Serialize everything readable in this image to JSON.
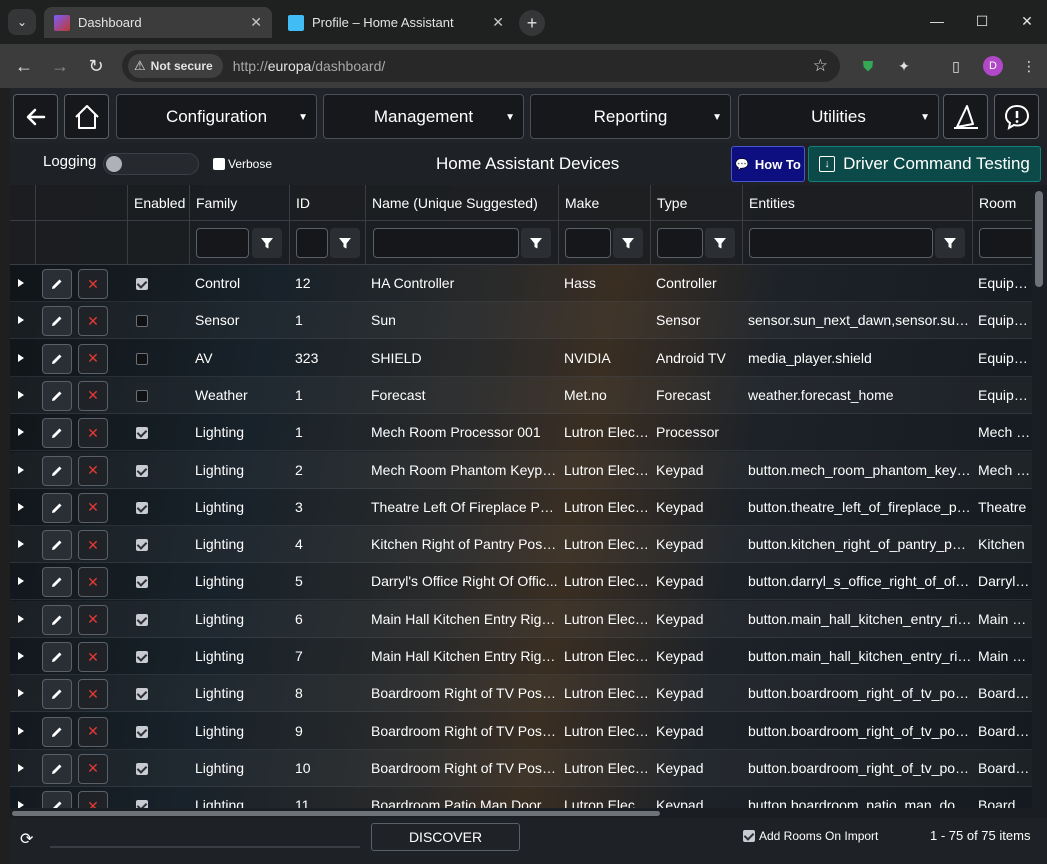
{
  "browser": {
    "tabs": [
      {
        "title": "Dashboard",
        "active": true
      },
      {
        "title": "Profile – Home Assistant",
        "active": false
      }
    ],
    "security_label": "Not secure",
    "url_prefix": "http://",
    "url_host": "europa",
    "url_path": "/dashboard/",
    "profile_initial": "D"
  },
  "nav": {
    "menus": [
      "Configuration",
      "Management",
      "Reporting",
      "Utilities"
    ]
  },
  "subbar": {
    "logging_label": "Logging",
    "verbose_label": "Verbose",
    "title": "Home Assistant Devices",
    "howto_label": "How To",
    "driver_test_label": "Driver Command Testing"
  },
  "grid": {
    "columns": [
      "Enabled",
      "Family",
      "ID",
      "Name (Unique Suggested)",
      "Make",
      "Type",
      "Entities",
      "Room"
    ],
    "rows": [
      {
        "enabled": true,
        "family": "Control",
        "id": "12",
        "name": "HA Controller",
        "make": "Hass",
        "type": "Controller",
        "entities": "",
        "room": "Equipme"
      },
      {
        "enabled": false,
        "family": "Sensor",
        "id": "1",
        "name": "Sun",
        "make": "",
        "type": "Sensor",
        "entities": "sensor.sun_next_dawn,sensor.sun_n...",
        "room": "Equipme"
      },
      {
        "enabled": false,
        "family": "AV",
        "id": "323",
        "name": "SHIELD",
        "make": "NVIDIA",
        "type": "Android TV",
        "entities": "media_player.shield",
        "room": "Equipme"
      },
      {
        "enabled": false,
        "family": "Weather",
        "id": "1",
        "name": "Forecast",
        "make": "Met.no",
        "type": "Forecast",
        "entities": "weather.forecast_home",
        "room": "Equipme"
      },
      {
        "enabled": true,
        "family": "Lighting",
        "id": "1",
        "name": "Mech Room Processor 001",
        "make": "Lutron Elect...",
        "type": "Processor",
        "entities": "",
        "room": "Mech Ro"
      },
      {
        "enabled": true,
        "family": "Lighting",
        "id": "2",
        "name": "Mech Room Phantom Keypa...",
        "make": "Lutron Elect...",
        "type": "Keypad",
        "entities": "button.mech_room_phantom_keyp...",
        "room": "Mech Ro"
      },
      {
        "enabled": true,
        "family": "Lighting",
        "id": "3",
        "name": "Theatre Left Of Fireplace Posi...",
        "make": "Lutron Elect...",
        "type": "Keypad",
        "entities": "button.theatre_left_of_fireplace_posi...",
        "room": "Theatre"
      },
      {
        "enabled": true,
        "family": "Lighting",
        "id": "4",
        "name": "Kitchen Right of Pantry Positi...",
        "make": "Lutron Elect...",
        "type": "Keypad",
        "entities": "button.kitchen_right_of_pantry_posi...",
        "room": "Kitchen"
      },
      {
        "enabled": true,
        "family": "Lighting",
        "id": "5",
        "name": "Darryl's Office Right Of Offic...",
        "make": "Lutron Elect...",
        "type": "Keypad",
        "entities": "button.darryl_s_office_right_of_offic...",
        "room": "Darryls C"
      },
      {
        "enabled": true,
        "family": "Lighting",
        "id": "6",
        "name": "Main Hall Kitchen Entry Right...",
        "make": "Lutron Elect...",
        "type": "Keypad",
        "entities": "button.main_hall_kitchen_entry_righ...",
        "room": "Main Hal"
      },
      {
        "enabled": true,
        "family": "Lighting",
        "id": "7",
        "name": "Main Hall Kitchen Entry Right...",
        "make": "Lutron Elect...",
        "type": "Keypad",
        "entities": "button.main_hall_kitchen_entry_righ...",
        "room": "Main Hal"
      },
      {
        "enabled": true,
        "family": "Lighting",
        "id": "8",
        "name": "Boardroom Right of TV Positi...",
        "make": "Lutron Elect...",
        "type": "Keypad",
        "entities": "button.boardroom_right_of_tv_posit...",
        "room": "Boardroo"
      },
      {
        "enabled": true,
        "family": "Lighting",
        "id": "9",
        "name": "Boardroom Right of TV Positi...",
        "make": "Lutron Elect...",
        "type": "Keypad",
        "entities": "button.boardroom_right_of_tv_posit...",
        "room": "Boardroo"
      },
      {
        "enabled": true,
        "family": "Lighting",
        "id": "10",
        "name": "Boardroom Right of TV Positi...",
        "make": "Lutron Elect...",
        "type": "Keypad",
        "entities": "button.boardroom_right_of_tv_posit...",
        "room": "Boardroo"
      },
      {
        "enabled": true,
        "family": "Lighting",
        "id": "11",
        "name": "Boardroom Patio Man Door...",
        "make": "Lutron Elect...",
        "type": "Keypad",
        "entities": "button.boardroom_patio_man_door...",
        "room": "Boardroo"
      }
    ]
  },
  "footer": {
    "discover_label": "DISCOVER",
    "add_rooms_label": "Add Rooms On Import",
    "page_info": "1 - 75 of 75 items"
  },
  "colors": {
    "howto_bg": "#0d0f80",
    "driver_test_bg": "#0b4a48",
    "delete_icon": "#e53935",
    "avatar": "#b148c7"
  }
}
